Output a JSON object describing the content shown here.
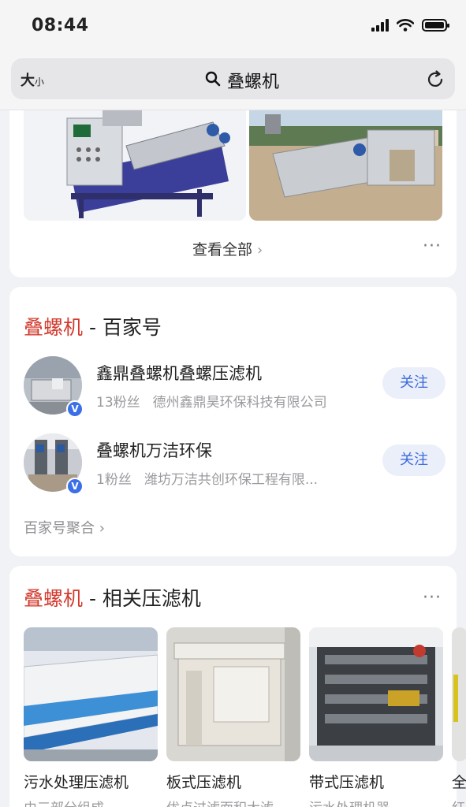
{
  "status_bar": {
    "time": "08:44"
  },
  "search": {
    "font_size_label_big": "大",
    "font_size_label_small": "小",
    "query": "叠螺机"
  },
  "image_card": {
    "view_all_label": "查看全部",
    "view_all_chevron": "›",
    "more_label": "···"
  },
  "baijiahao": {
    "keyword": "叠螺机",
    "suffix": " - 百家号",
    "accounts": [
      {
        "name": "鑫鼎叠螺机叠螺压滤机",
        "fans": "13粉丝",
        "description": "德州鑫鼎昊环保科技有限公司",
        "follow_label": "关注",
        "verified_mark": "V"
      },
      {
        "name": "叠螺机万洁环保",
        "fans": "1粉丝",
        "description": "潍坊万洁共创环保工程有限...",
        "follow_label": "关注",
        "verified_mark": "V"
      }
    ],
    "aggregate_label": "百家号聚合 ›"
  },
  "related": {
    "keyword": "叠螺机",
    "suffix": " - 相关压滤机",
    "more_label": "···",
    "products": [
      {
        "name": "污水处理压滤机",
        "desc": "由三部分组成"
      },
      {
        "name": "板式压滤机",
        "desc": "优点过滤面积大滤"
      },
      {
        "name": "带式压滤机",
        "desc": "污水处理机器"
      },
      {
        "name": "全",
        "desc": "红"
      }
    ]
  },
  "colors": {
    "keyword_red": "#d23a2e",
    "follow_blue": "#3b6bdc",
    "verified_blue": "#3a6fe8"
  }
}
